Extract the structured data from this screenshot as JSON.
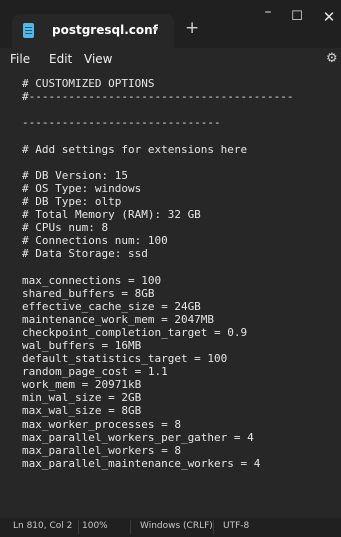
{
  "tab": {
    "title": "postgresql.conf",
    "modified_indicator": "•",
    "new_tab_label": "+"
  },
  "window_controls": {
    "minimize": "–",
    "maximize": "☐",
    "close": "✕"
  },
  "menu": {
    "file": "File",
    "edit": "Edit",
    "view": "View",
    "settings_icon": "gear-icon"
  },
  "editor": {
    "lines": [
      "---------------------------",
      "# CUSTOMIZED OPTIONS",
      "#----------------------------------------",
      "",
      "------------------------------",
      "",
      "# Add settings for extensions here",
      "",
      "# DB Version: 15",
      "# OS Type: windows",
      "# DB Type: oltp",
      "# Total Memory (RAM): 32 GB",
      "# CPUs num: 8",
      "# Connections num: 100",
      "# Data Storage: ssd",
      "",
      "max_connections = 100",
      "shared_buffers = 8GB",
      "effective_cache_size = 24GB",
      "maintenance_work_mem = 2047MB",
      "checkpoint_completion_target = 0.9",
      "wal_buffers = 16MB",
      "default_statistics_target = 100",
      "random_page_cost = 1.1",
      "work_mem = 20971kB",
      "min_wal_size = 2GB",
      "max_wal_size = 8GB",
      "max_worker_processes = 8",
      "max_parallel_workers_per_gather = 4",
      "max_parallel_workers = 8",
      "max_parallel_maintenance_workers = 4"
    ]
  },
  "status": {
    "position": "Ln 810, Col 2",
    "zoom": "100%",
    "line_ending": "Windows (CRLF)",
    "encoding": "UTF-8"
  },
  "colors": {
    "background": "#272727",
    "titlebar": "#202020",
    "text": "#e6e6e6",
    "app_icon": "#52b8e8"
  }
}
